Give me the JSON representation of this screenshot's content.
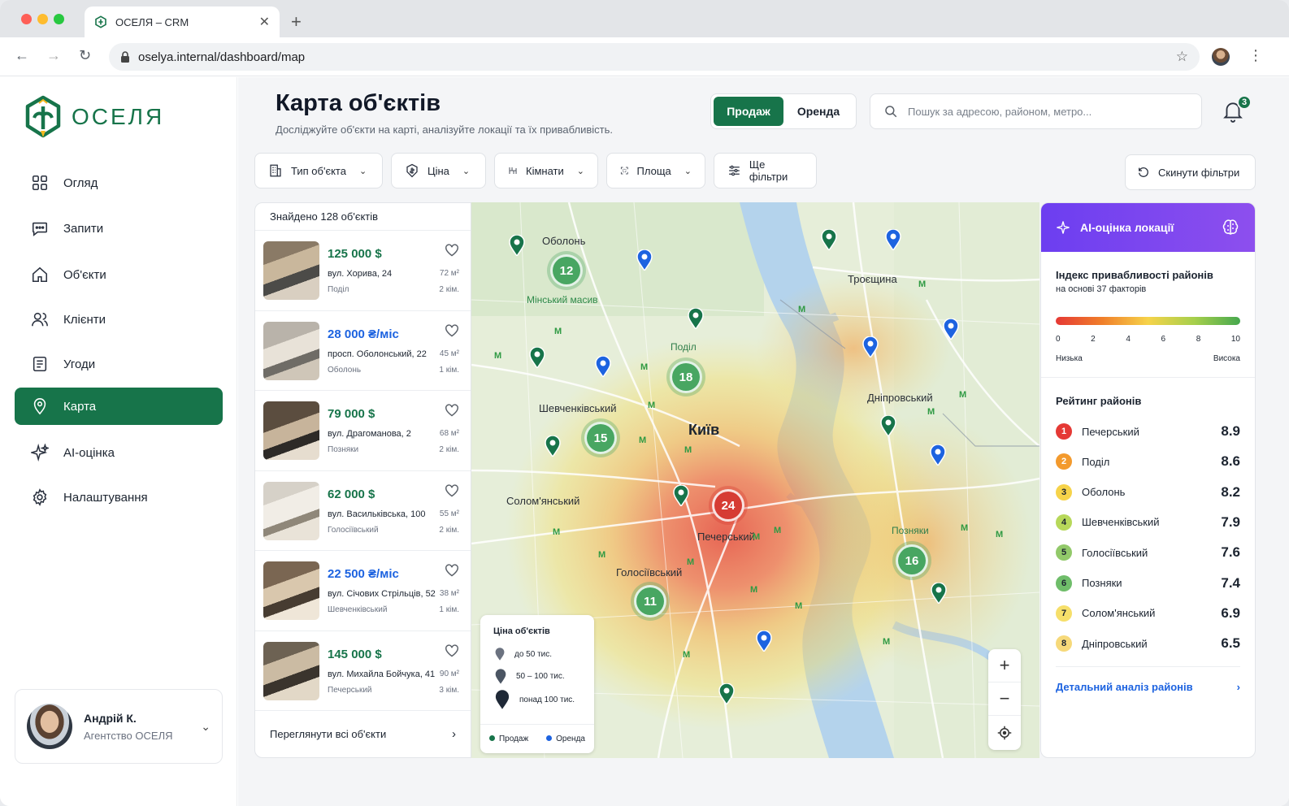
{
  "browser": {
    "tab_title": "ОСЕЛЯ – CRM",
    "url": "oselya.internal/dashboard/map"
  },
  "brand": {
    "name": "ОСЕЛЯ",
    "accent": "#17744a"
  },
  "sidebar": {
    "items": [
      {
        "label": "Огляд",
        "icon": "dashboard-grid-icon"
      },
      {
        "label": "Запити",
        "icon": "chat-icon"
      },
      {
        "label": "Об'єкти",
        "icon": "home-icon"
      },
      {
        "label": "Клієнти",
        "icon": "users-icon"
      },
      {
        "label": "Угоди",
        "icon": "document-icon"
      },
      {
        "label": "Карта",
        "icon": "map-pin-icon",
        "active": true
      },
      {
        "label": "AI-оцінка",
        "icon": "sparkles-icon"
      },
      {
        "label": "Налаштування",
        "icon": "gear-icon"
      }
    ],
    "user": {
      "name": "Андрій К.",
      "org": "Агентство ОСЕЛЯ"
    }
  },
  "header": {
    "title": "Карта об'єктів",
    "subtitle": "Досліджуйте об'єкти на карті, аналізуйте локації та їх привабливість.",
    "toggle": {
      "sale": "Продаж",
      "rent": "Оренда",
      "selected": "sale"
    },
    "search_placeholder": "Пошук за адресою, районом, метро...",
    "notifications": "3"
  },
  "filters": {
    "type": "Тип об'єкта",
    "price": "Ціна",
    "rooms": "Кімнати",
    "area": "Площа",
    "more": "Ще фільтри",
    "reset": "Скинути фільтри"
  },
  "listings": {
    "found": "Знайдено 128 об'єктів",
    "footer": "Переглянути всі об'єкти",
    "items": [
      {
        "price": "125 000 $",
        "kind": "sale",
        "address": "вул. Хорива, 24",
        "district": "Поділ",
        "area": "72 м²",
        "rooms": "2 кім."
      },
      {
        "price": "28 000 ₴/міс",
        "kind": "rent",
        "address": "просп. Оболонський, 22",
        "district": "Оболонь",
        "area": "45 м²",
        "rooms": "1 кім."
      },
      {
        "price": "79 000 $",
        "kind": "sale",
        "address": "вул. Драгоманова, 2",
        "district": "Позняки",
        "area": "68 м²",
        "rooms": "2 кім."
      },
      {
        "price": "62 000 $",
        "kind": "sale",
        "address": "вул. Васильківська, 100",
        "district": "Голосіївський",
        "area": "55 м²",
        "rooms": "2 кім."
      },
      {
        "price": "22 500 ₴/міс",
        "kind": "rent",
        "address": "вул. Січових Стрільців, 52",
        "district": "Шевченківський",
        "area": "38 м²",
        "rooms": "1 кім."
      },
      {
        "price": "145 000 $",
        "kind": "sale",
        "address": "вул. Михайла Бойчука, 41",
        "district": "Печерський",
        "area": "90 м²",
        "rooms": "3 кім."
      }
    ]
  },
  "map": {
    "labels": {
      "obolon": "Оболонь",
      "minsky": "Мінський масив",
      "troieshchyna": "Троєщина",
      "podil": "Поділ",
      "shevchenkivskyi": "Шевченківський",
      "kyiv": "Київ",
      "dniprovskyi": "Дніпровський",
      "solomianskyi": "Солом'янський",
      "pecherskyi": "Печерський",
      "pozniaky": "Позняки",
      "holosiivskyi": "Голосіївський"
    },
    "clusters": [
      "12",
      "18",
      "15",
      "24",
      "16",
      "11"
    ],
    "metro_symbol": "M",
    "legend": {
      "title": "Ціна об'єктів",
      "tier1": "до 50 тис.",
      "tier2": "50 – 100 тис.",
      "tier3": "понад 100 тис.",
      "sale": "Продаж",
      "rent": "Оренда",
      "sale_color": "#17744a",
      "rent_color": "#1d63e0"
    },
    "zoom_in": "+",
    "zoom_out": "−"
  },
  "ai_panel": {
    "title": "AI-оцінка локації",
    "index_title": "Індекс привабливості районів",
    "index_subtitle": "на основі 37 факторів",
    "scale_ticks": [
      "0",
      "2",
      "4",
      "6",
      "8",
      "10"
    ],
    "scale_low": "Низька",
    "scale_high": "Висока",
    "rating_title": "Рейтинг районів",
    "ranking": [
      {
        "rank": "1",
        "name": "Печерський",
        "score": "8.9",
        "color": "#e53935"
      },
      {
        "rank": "2",
        "name": "Поділ",
        "score": "8.6",
        "color": "#f39a2d"
      },
      {
        "rank": "3",
        "name": "Оболонь",
        "score": "8.2",
        "color": "#f6d34a"
      },
      {
        "rank": "4",
        "name": "Шевченківський",
        "score": "7.9",
        "color": "#b7d85a"
      },
      {
        "rank": "5",
        "name": "Голосіївський",
        "score": "7.6",
        "color": "#92c96a"
      },
      {
        "rank": "6",
        "name": "Позняки",
        "score": "7.4",
        "color": "#6fbd6a"
      },
      {
        "rank": "7",
        "name": "Солом'янський",
        "score": "6.9",
        "color": "#f6df6a"
      },
      {
        "rank": "8",
        "name": "Дніпровський",
        "score": "6.5",
        "color": "#f6d97a"
      }
    ],
    "link": "Детальний аналіз районів"
  }
}
